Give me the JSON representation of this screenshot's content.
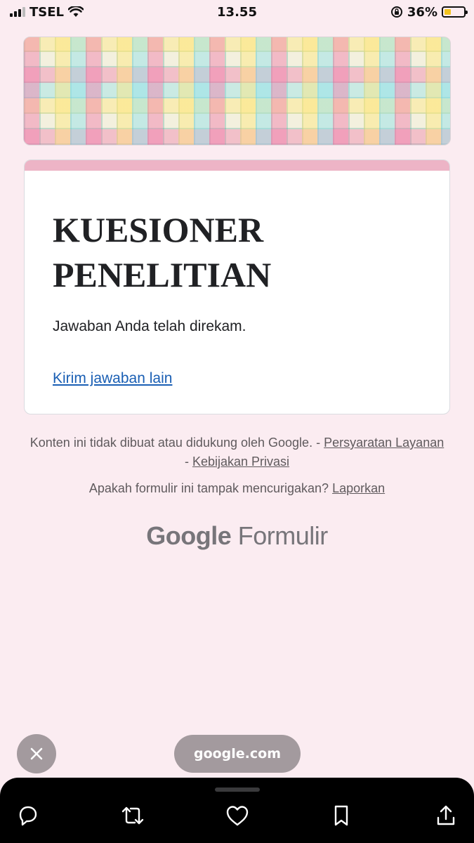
{
  "status_bar": {
    "carrier": "TSEL",
    "time": "13.55",
    "battery_percent": "36%",
    "battery_level": 0.36
  },
  "form": {
    "title_line1": "KUESIONER",
    "title_line2": "PENELITIAN",
    "confirmation": "Jawaban Anda telah direkam.",
    "resubmit_link": "Kirim jawaban lain",
    "accent_color": "#edb4c6"
  },
  "footer": {
    "disclaimer": "Konten ini tidak dibuat atau didukung oleh Google.",
    "separator": "-",
    "terms_link": "Persyaratan Layanan",
    "privacy_link": "Kebijakan Privasi",
    "report_question": "Apakah formulir ini tampak mencurigakan?",
    "report_link": "Laporkan",
    "logo_google": "Google",
    "logo_product": "Formulir"
  },
  "browser_overlay": {
    "url": "google.com"
  },
  "icons": {
    "close": "close-icon",
    "reply": "reply-icon",
    "retweet": "retweet-icon",
    "like": "heart-icon",
    "bookmark": "bookmark-icon",
    "share": "share-icon"
  }
}
